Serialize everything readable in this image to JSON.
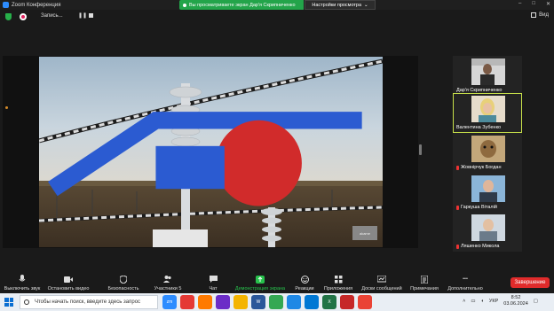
{
  "window": {
    "title": "Zoom Конференция"
  },
  "recording": {
    "label": "Запись..."
  },
  "share_banner": {
    "text": "Вы просматриваете экран Дар'я Скрипниченко"
  },
  "view_options": {
    "label": "Настройки просмотра"
  },
  "view_button": {
    "label": "Вид"
  },
  "shared_screen": {
    "watermark_text": "akame"
  },
  "participants": [
    {
      "name": "Дар'я Скрипниченко",
      "muted": false,
      "active": false
    },
    {
      "name": "Валентина Зубенко",
      "muted": false,
      "active": true
    },
    {
      "name": "Жовнірчук Богдан",
      "muted": true,
      "active": false
    },
    {
      "name": "Гаркуша Віталій",
      "muted": true,
      "active": false
    },
    {
      "name": "Ляшенко Микола",
      "muted": true,
      "active": false
    }
  ],
  "toolbar": {
    "mute": "Выключить звук",
    "video": "Остановить видео",
    "security": "Безопасность",
    "participants": "Участники",
    "participants_count": "5",
    "chat": "Чат",
    "share": "Демонстрация экрана",
    "reactions": "Реакции",
    "apps": "Приложения",
    "whiteboard": "Доски сообщений",
    "notes": "Примечания",
    "more": "Дополнительно",
    "end": "Завершение"
  },
  "taskbar": {
    "search_placeholder": "Чтобы начать поиск, введите здесь запрос",
    "language": "УКР",
    "time": "8:52",
    "date": "03.06.2024"
  },
  "colors": {
    "accent_green": "#23a44a",
    "end_red": "#e02b2b",
    "zoom_blue": "#2d8cff",
    "active_speaker": "#c7e04a"
  }
}
